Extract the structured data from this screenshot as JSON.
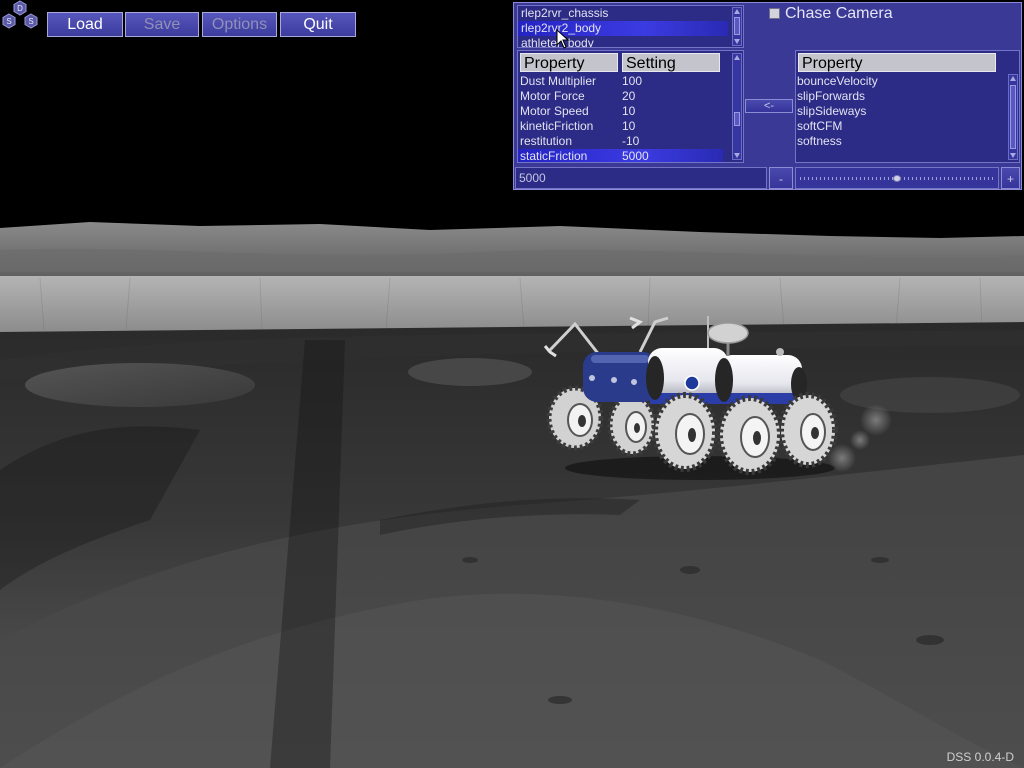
{
  "app": {
    "version_label": "DSS 0.0.4-D"
  },
  "logo": {
    "letters": [
      "D",
      "S",
      "S"
    ]
  },
  "toolbar": {
    "load": "Load",
    "save": "Save",
    "options": "Options",
    "quit": "Quit"
  },
  "panel": {
    "bodies": [
      "rlep2rvr_chassis",
      "rlep2rvr2_body",
      "athleter_body"
    ],
    "selected_body_index": 1,
    "table": {
      "headers": [
        "Property",
        "Setting"
      ],
      "rows": [
        {
          "property": "Dust Multiplier",
          "setting": "100"
        },
        {
          "property": "Motor Force",
          "setting": "20"
        },
        {
          "property": "Motor Speed",
          "setting": "10"
        },
        {
          "property": "kineticFriction",
          "setting": "10"
        },
        {
          "property": "restitution",
          "setting": "-10"
        },
        {
          "property": "staticFriction",
          "setting": "5000"
        }
      ],
      "selected_row_index": 5
    },
    "move_button": "<-",
    "available_properties": {
      "header": "Property",
      "items": [
        "bounceVelocity",
        "slipForwards",
        "slipSideways",
        "softCFM",
        "softness"
      ]
    },
    "value_field": "5000",
    "decrement_button": "-",
    "increment_button": "+",
    "slider_level": 0.5,
    "chase_camera": {
      "label": "Chase Camera",
      "checked": false
    }
  },
  "icons": {
    "logo": "dss-hexagon-logo",
    "scroll_up": "scroll-up-arrow-icon",
    "scroll_down": "scroll-down-arrow-icon",
    "cursor": "mouse-cursor-icon",
    "checkbox": "checkbox-icon"
  },
  "colors": {
    "panel": "#3a3a96",
    "list": "#2c2c86",
    "selection": "#2a2ad0",
    "header": "#c4c4cc",
    "button": "#4646aa",
    "sky": "#000000",
    "regolith": "#3a3a3a"
  }
}
